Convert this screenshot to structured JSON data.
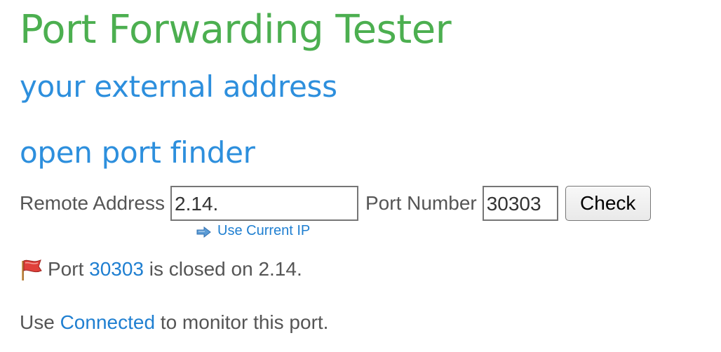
{
  "title": "Port Forwarding Tester",
  "sections": {
    "external_address": "your external address",
    "open_port_finder": "open port finder"
  },
  "form": {
    "remote_address_label": "Remote Address",
    "remote_address_value": "2.14.",
    "port_number_label": "Port Number",
    "port_number_value": "30303",
    "check_button": "Check",
    "use_current_ip": "Use Current IP"
  },
  "result": {
    "prefix": "Port",
    "port": "30303",
    "middle": "is closed on",
    "address": "2.14."
  },
  "monitor": {
    "prefix": "Use",
    "link": "Connected",
    "suffix": "to monitor this port."
  },
  "colors": {
    "title": "#4caf50",
    "heading": "#2d8fdd",
    "link": "#1f7fd1",
    "text": "#555555",
    "flag": "#e0403a"
  },
  "icons": {
    "result_status": "red-flag-icon",
    "use_ip": "arrow-pointer-icon"
  }
}
